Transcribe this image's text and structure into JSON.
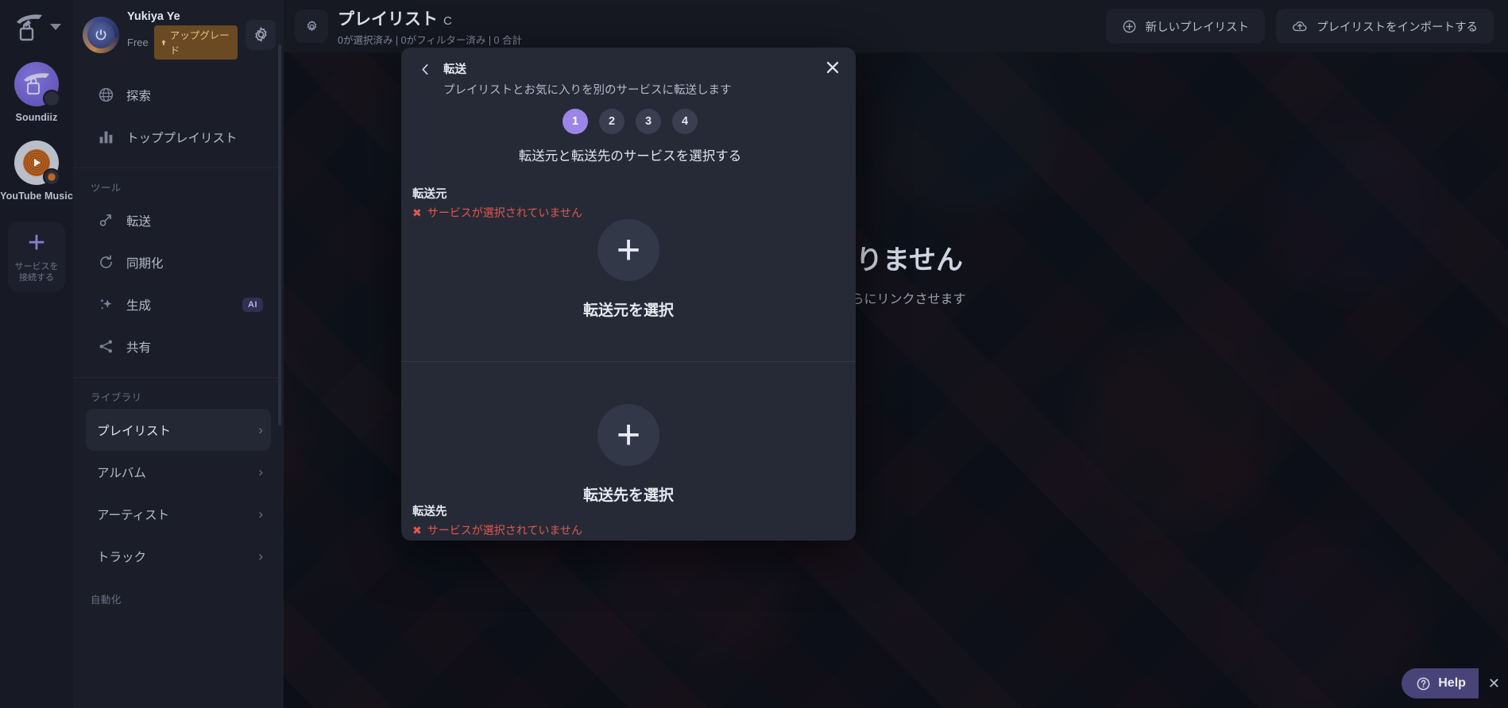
{
  "rail": {
    "logo_icon": "soundiiz-hand-logo",
    "caret_icon": "chevron-down-icon",
    "services": [
      {
        "name": "Soundiiz",
        "icon": "soundiiz-avatar-icon"
      },
      {
        "name": "YouTube Music",
        "icon": "youtube-music-icon"
      }
    ],
    "connect": {
      "plus": "+",
      "label": "サービスを接続する",
      "icon": "plus-icon"
    }
  },
  "sidebar": {
    "account": {
      "name": "Yukiya Ye",
      "plan": "Free",
      "upgrade_label": "アップグレード",
      "upgrade_icon": "arrow-up-icon",
      "avatar_icon": "power-avatar-icon",
      "settings_icon": "gear-icon"
    },
    "top_items": [
      {
        "label": "探索",
        "icon": "globe-icon"
      },
      {
        "label": "トッププレイリスト",
        "icon": "bar-chart-icon"
      }
    ],
    "tools_label": "ツール",
    "tools": [
      {
        "label": "転送",
        "icon": "transfer-icon",
        "badge": ""
      },
      {
        "label": "同期化",
        "icon": "sync-icon",
        "badge": ""
      },
      {
        "label": "生成",
        "icon": "sparkle-icon",
        "badge": "AI"
      },
      {
        "label": "共有",
        "icon": "share-icon",
        "badge": ""
      }
    ],
    "library_label": "ライブラリ",
    "library": [
      {
        "label": "プレイリスト",
        "active": true,
        "chevron": "›"
      },
      {
        "label": "アルバム",
        "active": false,
        "chevron": "›"
      },
      {
        "label": "アーティスト",
        "active": false,
        "chevron": "›"
      },
      {
        "label": "トラック",
        "active": false,
        "chevron": "›"
      }
    ],
    "automation_label": "自動化"
  },
  "header": {
    "refresh_icon": "refresh-gear-icon",
    "title": "プレイリスト",
    "title_suffix": "C",
    "meta": "0が選択済み | 0がフィルター済み | 0 合計",
    "buttons": [
      {
        "label": "新しいプレイリスト",
        "icon": "plus-circle-icon"
      },
      {
        "label": "プレイリストをインポートする",
        "icon": "cloud-upload-icon"
      }
    ]
  },
  "empty_state": {
    "title": "ありません",
    "subtitle": "をさらにリンクさせます"
  },
  "modal": {
    "back_icon": "chevron-left-icon",
    "title": "転送",
    "description": "プレイリストとお気に入りを別のサービスに転送します",
    "close_icon": "close-icon",
    "steps": [
      "1",
      "2",
      "3",
      "4"
    ],
    "active_step": "1",
    "caption": "転送元と転送先のサービスを選択する",
    "source": {
      "title": "転送元",
      "error_icon": "✖",
      "error": "サービスが選択されていません",
      "plus": "+",
      "button_label": "転送元を選択"
    },
    "destination": {
      "title": "転送先",
      "error_icon": "✖",
      "error": "サービスが選択されていません",
      "plus": "+",
      "button_label": "転送先を選択"
    }
  },
  "help": {
    "label": "Help",
    "icon": "help-circle-icon",
    "close": "✕"
  },
  "colors": {
    "accent": "#9b86e8",
    "error": "#e4564c",
    "upgrade": "#e7c089",
    "help": "#484378"
  }
}
